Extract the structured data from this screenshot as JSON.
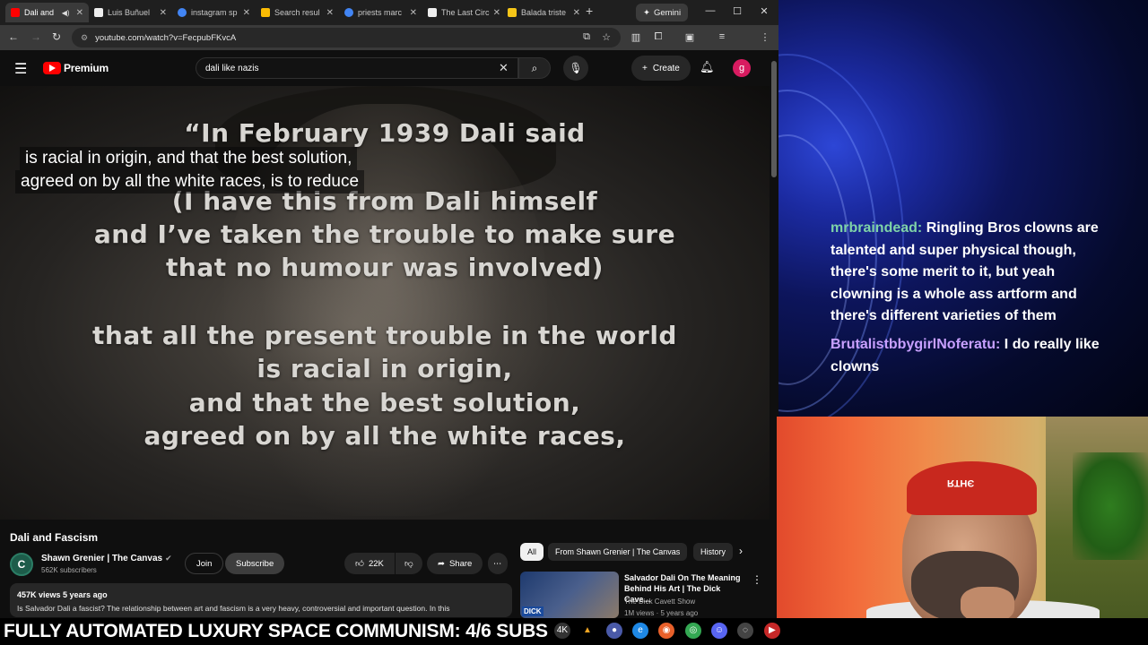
{
  "browser": {
    "tabs": [
      {
        "label": "Dali and",
        "fav_color": "#ff0000",
        "active": true
      },
      {
        "label": "Luis Buñuel",
        "fav_color": "#eeeeee"
      },
      {
        "label": "instagram sp",
        "fav_color": "#4285f4"
      },
      {
        "label": "Search resul",
        "fav_color": "#fbbc04"
      },
      {
        "label": "priests marc",
        "fav_color": "#4285f4"
      },
      {
        "label": "The Last Circ",
        "fav_color": "#eeeeee"
      },
      {
        "label": "Balada triste",
        "fav_color": "#f5c518"
      }
    ],
    "gemini_label": "Gemini",
    "url": "youtube.com/watch?v=FecpubFKvcA",
    "profile_initial": "g"
  },
  "youtube": {
    "logo_label": "Premium",
    "search_query": "dali like nazis",
    "create_label": "Create",
    "avatar_initial": "g",
    "video": {
      "quote_lines": [
        "“In February 1939 Dali said",
        "(I have this from Dali himself",
        "and I’ve taken the trouble to make sure",
        "that no humour was involved)",
        "that all the present trouble in the world",
        "is racial in origin,",
        "and that the best solution,",
        "agreed on by all the white races,"
      ],
      "captions": [
        "is racial in origin, and that the best solution,",
        "agreed on by all the white races, is to reduce"
      ]
    },
    "title": "Dali and Fascism",
    "channel": {
      "initial": "C",
      "name": "Shawn Grenier | The Canvas",
      "subs": "562K subscribers",
      "join_label": "Join",
      "subscribe_label": "Subscribe"
    },
    "actions": {
      "likes": "22K",
      "share_label": "Share"
    },
    "meta": {
      "stats": "457K views  5 years ago",
      "description": "Is Salvador Dali a fascist? The relationship between art and fascism is a very heavy, controversial and important question. In this"
    },
    "chips": [
      "All",
      "From Shawn Grenier | The Canvas",
      "History"
    ],
    "recommendation": {
      "title": "Salvador Dali On The Meaning Behind His Art | The Dick Cave...",
      "channel": "The Dick Cavett Show",
      "views": "1M views · 5 years ago",
      "thumb_logo": "DICK"
    }
  },
  "chat": [
    {
      "user": "mrbraindead:",
      "user_color": "#7fd3a8",
      "message": "Ringling Bros clowns are talented and super physical though, there's some merit to it, but yeah clowning is a whole ass artform and there's different varieties of them"
    },
    {
      "user": "BrutalistbbygirlNoferatu:",
      "user_color": "#c8a0ff",
      "message": "I do really like clowns"
    }
  ],
  "webcam": {
    "cap_text": "ЭНТЯ"
  },
  "ticker": "FULLY AUTOMATED LUXURY SPACE COMMUNISM: 4/6 SUBS",
  "colors": {
    "yt_red": "#ff0000",
    "yt_bg": "#0f0f0f",
    "wallpaper_blue": "#1b2aa0"
  }
}
